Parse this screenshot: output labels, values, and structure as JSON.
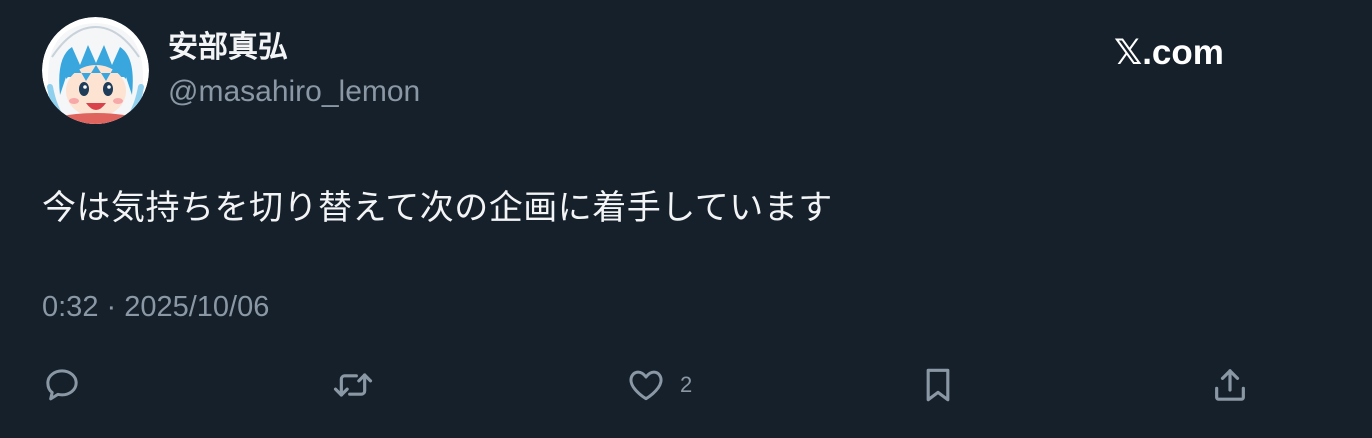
{
  "post": {
    "display_name": "安部真弘",
    "handle": "@masahiro_lemon",
    "brand": "𝕏.com",
    "text": "今は気持ちを切り替えて次の企画に着手しています",
    "timestamp": "0:32 · 2025/10/06"
  },
  "actions": {
    "reply_icon": "speech-bubble-icon",
    "repost_icon": "repost-arrows-icon",
    "like_icon": "heart-icon",
    "like_count": "2",
    "bookmark_icon": "bookmark-icon",
    "share_icon": "share-upload-icon"
  },
  "colors": {
    "background": "#16202b",
    "text_primary": "#f2f4f5",
    "text_secondary": "#8a98a5"
  }
}
